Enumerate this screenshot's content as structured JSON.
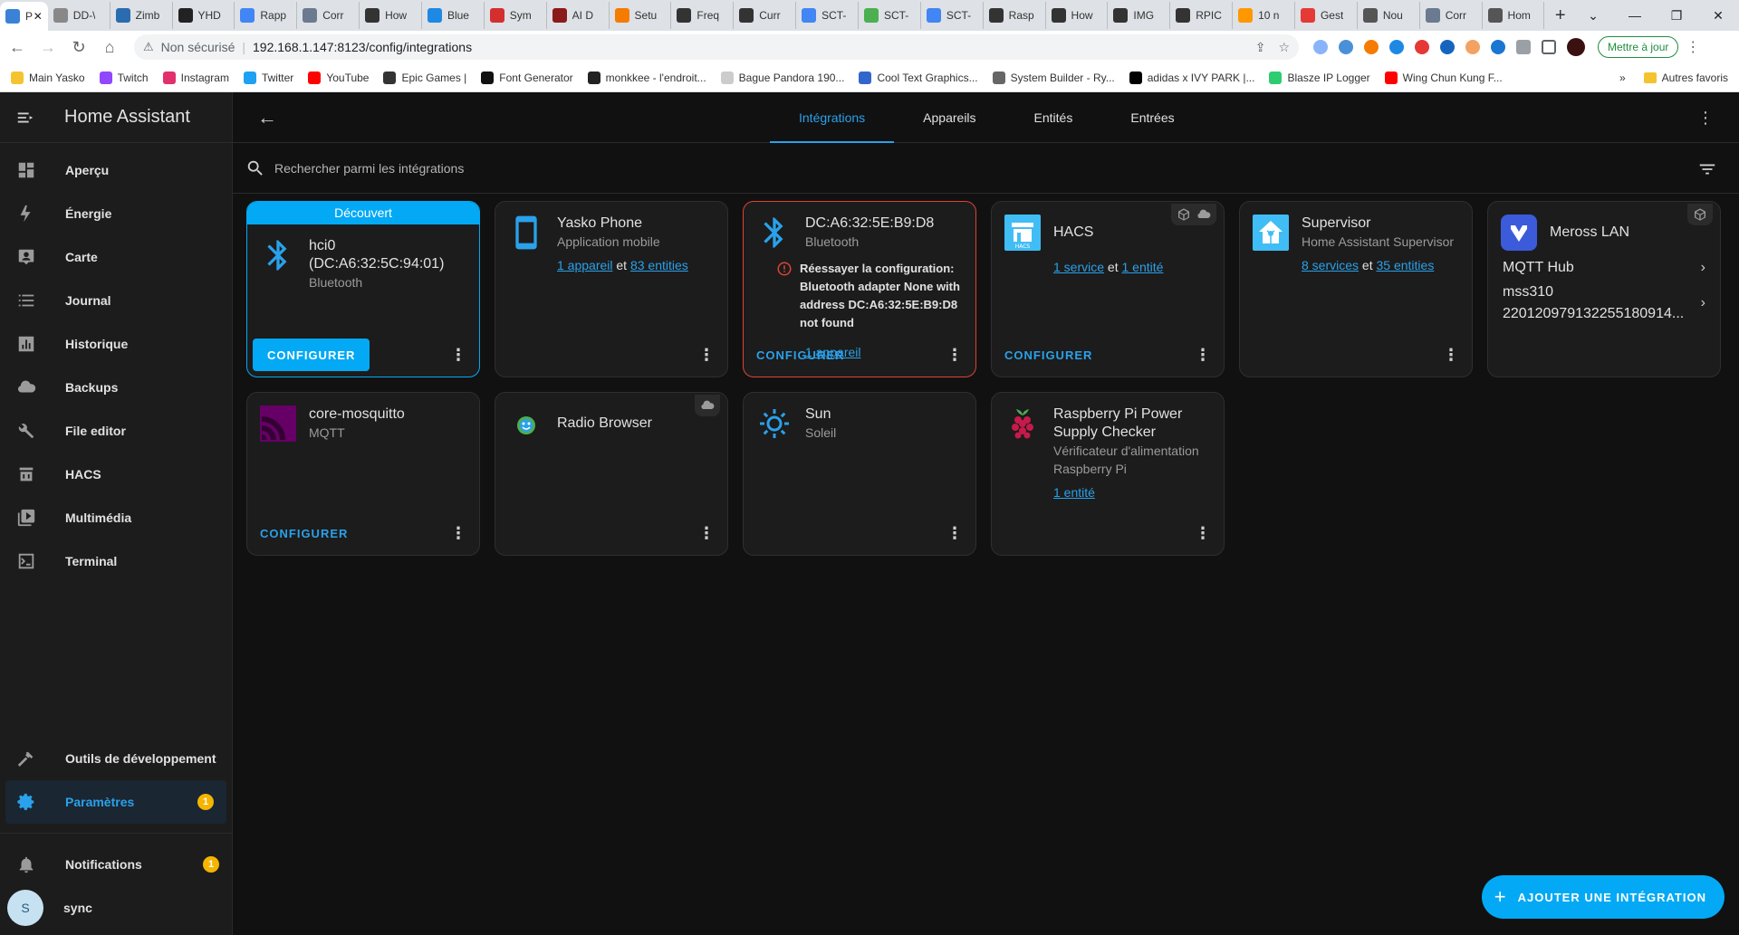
{
  "browser": {
    "tabs": [
      {
        "label": "P",
        "color": "#3b82d6",
        "active": true
      },
      {
        "label": "DD-\\",
        "color": "#888888"
      },
      {
        "label": "Zimb",
        "color": "#2b6cb0"
      },
      {
        "label": "YHD",
        "color": "#222222"
      },
      {
        "label": "Rapp",
        "color": "#4285f4"
      },
      {
        "label": "Corr",
        "color": "#6b7a8f"
      },
      {
        "label": "How",
        "color": "#333333"
      },
      {
        "label": "Blue",
        "color": "#1e88e5"
      },
      {
        "label": "Sym",
        "color": "#d32f2f"
      },
      {
        "label": "AI D",
        "color": "#8b1a1a"
      },
      {
        "label": "Setu",
        "color": "#f57c00"
      },
      {
        "label": "Freq",
        "color": "#333333"
      },
      {
        "label": "Curr",
        "color": "#333333"
      },
      {
        "label": "SCT-",
        "color": "#4285f4"
      },
      {
        "label": "SCT-",
        "color": "#4caf50"
      },
      {
        "label": "SCT-",
        "color": "#4285f4"
      },
      {
        "label": "Rasp",
        "color": "#333333"
      },
      {
        "label": "How",
        "color": "#333333"
      },
      {
        "label": "IMG",
        "color": "#333333"
      },
      {
        "label": "RPIC",
        "color": "#333333"
      },
      {
        "label": "10 n",
        "color": "#ff9800"
      },
      {
        "label": "Gest",
        "color": "#e53935"
      },
      {
        "label": "Nou",
        "color": "#555555"
      },
      {
        "label": "Corr",
        "color": "#6b7a8f"
      },
      {
        "label": "Hom",
        "color": "#555555"
      }
    ],
    "tab_close": "✕",
    "new_tab": "+",
    "win_minimize": "⌄",
    "win_min": "—",
    "win_max": "❐",
    "win_close": "✕",
    "insecure_label": "Non sécurisé",
    "url": "192.168.1.147:8123/config/integrations",
    "update_label": "Mettre à jour",
    "bookmarks": [
      {
        "label": "Main Yasko",
        "color": "#f4c430"
      },
      {
        "label": "Twitch",
        "color": "#9146ff"
      },
      {
        "label": "Instagram",
        "color": "#e1306c"
      },
      {
        "label": "Twitter",
        "color": "#1da1f2"
      },
      {
        "label": "YouTube",
        "color": "#ff0000"
      },
      {
        "label": "Epic Games |",
        "color": "#333333"
      },
      {
        "label": "Font Generator",
        "color": "#111111"
      },
      {
        "label": "monkkee - l'endroit...",
        "color": "#222222"
      },
      {
        "label": "Bague Pandora 190...",
        "color": "#cccccc"
      },
      {
        "label": "Cool Text Graphics...",
        "color": "#3366cc"
      },
      {
        "label": "System Builder - Ry...",
        "color": "#666666"
      },
      {
        "label": "adidas x IVY PARK |...",
        "color": "#000000"
      },
      {
        "label": "Blasze IP Logger",
        "color": "#2ecc71"
      },
      {
        "label": "Wing Chun Kung F...",
        "color": "#ff0000"
      }
    ],
    "bookmarks_more": "»",
    "other_bookmarks": "Autres favoris"
  },
  "sidebar": {
    "title": "Home Assistant",
    "items": [
      {
        "label": "Aperçu",
        "icon": "dashboard-icon"
      },
      {
        "label": "Énergie",
        "icon": "lightning-icon"
      },
      {
        "label": "Carte",
        "icon": "map-icon"
      },
      {
        "label": "Journal",
        "icon": "list-icon"
      },
      {
        "label": "Historique",
        "icon": "chart-icon"
      },
      {
        "label": "Backups",
        "icon": "cloud-icon"
      },
      {
        "label": "File editor",
        "icon": "wrench-icon"
      },
      {
        "label": "HACS",
        "icon": "hacs-icon"
      },
      {
        "label": "Multimédia",
        "icon": "play-icon"
      },
      {
        "label": "Terminal",
        "icon": "terminal-icon"
      }
    ],
    "dev_tools": "Outils de développement",
    "settings": "Paramètres",
    "settings_badge": "1",
    "notifications": "Notifications",
    "notifications_badge": "1",
    "user_initial": "S",
    "user_name": "sync"
  },
  "header": {
    "back": "←",
    "tabs": [
      "Intégrations",
      "Appareils",
      "Entités",
      "Entrées"
    ],
    "active_tab": 0,
    "kebab": "⋮"
  },
  "search": {
    "placeholder": "Rechercher parmi les intégrations"
  },
  "cards": [
    {
      "discovered_label": "Découvert",
      "title": "hci0 (DC:A6:32:5C:94:01)",
      "subtitle": "Bluetooth",
      "action": "CONFIGURER"
    },
    {
      "title": "Yasko Phone",
      "subtitle": "Application mobile",
      "link1": "1 appareil",
      "joiner": "et",
      "link2": "83 entities"
    },
    {
      "title": "DC:A6:32:5E:B9:D8",
      "subtitle": "Bluetooth",
      "error": "Réessayer la configuration: Bluetooth adapter None with address DC:A6:32:5E:B9:D8 not found",
      "link1": "1 appareil",
      "action": "CONFIGURER"
    },
    {
      "title": "HACS",
      "link1": "1 service",
      "joiner": "et",
      "link2": "1 entité",
      "action": "CONFIGURER"
    },
    {
      "title": "Supervisor",
      "subtitle": "Home Assistant Supervisor",
      "link1": "8 services",
      "joiner": "et",
      "link2": "35 entities"
    },
    {
      "title": "Meross LAN",
      "hub1": "MQTT Hub",
      "hub2_line1": "mss310",
      "hub2_line2": "220120979132255180914..."
    },
    {
      "title": "core-mosquitto",
      "subtitle": "MQTT",
      "action": "CONFIGURER"
    },
    {
      "title": "Radio Browser"
    },
    {
      "title": "Sun",
      "subtitle": "Soleil"
    },
    {
      "title": "Raspberry Pi Power Supply Checker",
      "subtitle": "Vérificateur d'alimentation Raspberry Pi",
      "link1": "1 entité"
    }
  ],
  "card_kebab": "⋮",
  "chevron": "›",
  "fab": {
    "plus": "+",
    "label": "AJOUTER UNE INTÉGRATION"
  },
  "colors": {
    "accent": "#03a9f4",
    "link": "#2aa1ea",
    "error": "#db4437",
    "badge": "#f4b400"
  }
}
